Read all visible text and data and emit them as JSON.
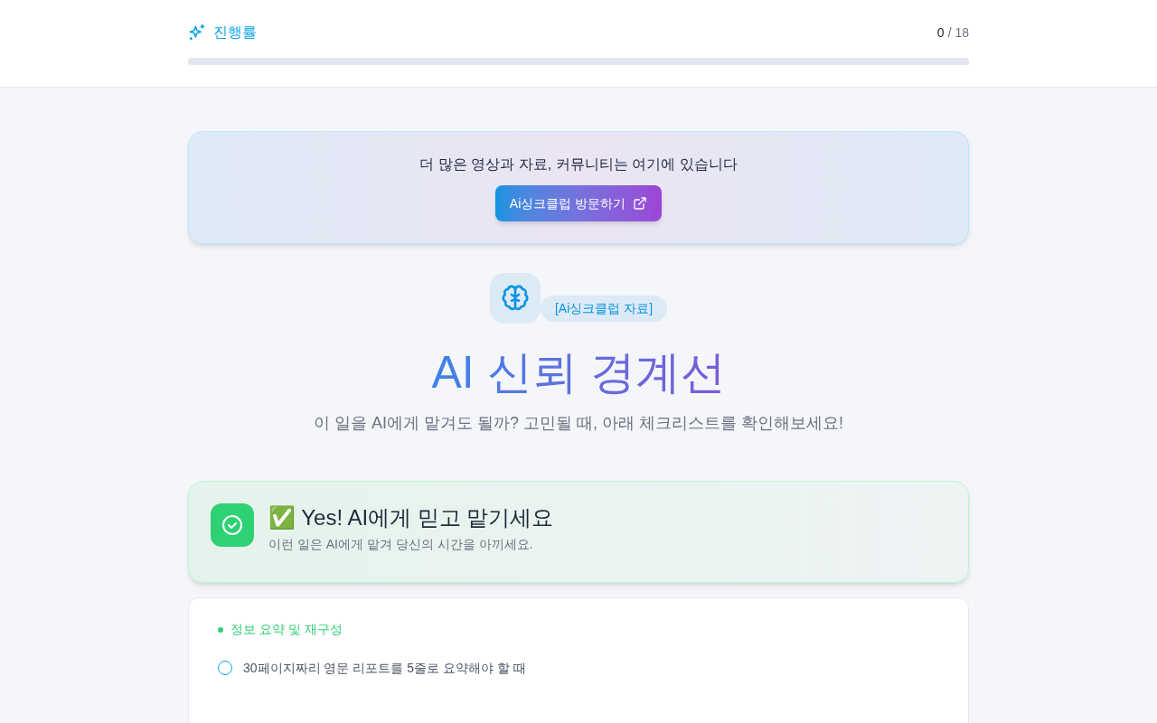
{
  "progress": {
    "label": "진행률",
    "done": "0",
    "total": "/ 18",
    "level": 0
  },
  "banner": {
    "text": "더 많은 영상과 자료, 커뮤니티는 여기에 있습니다",
    "button": "Ai싱크클럽 방문하기"
  },
  "hero": {
    "badge": "[Ai싱크클럽 자료]",
    "title": "AI 신뢰 경계선",
    "subtitle": "이 일을 AI에게 맡겨도 될까? 고민될 때, 아래 체크리스트를 확인해보세요!"
  },
  "section": {
    "title": "✅ Yes! AI에게 믿고 맡기세요",
    "subtitle": "이런 일은 AI에게 맡겨 당신의 시간을 아끼세요."
  },
  "checklist": {
    "category": "정보 요약 및 재구성",
    "items": [
      {
        "text": "30페이지짜리 영문 리포트를 5줄로 요약해야 할 때",
        "checked": false
      }
    ]
  }
}
